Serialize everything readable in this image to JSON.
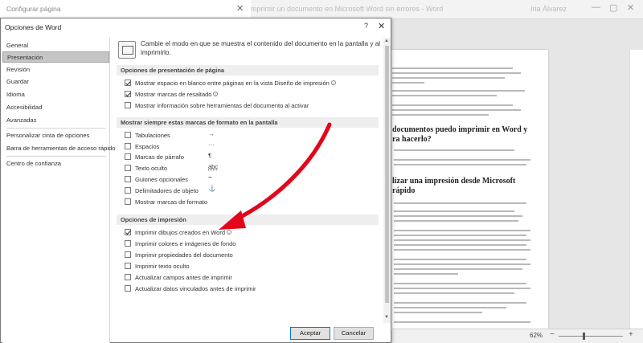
{
  "word": {
    "title": "imprimir un documento en Microsoft Word sin errores  -  Word",
    "user": "Iria Álvarez",
    "zoom": "62%",
    "headings": [
      "documentos puedo imprimir en Word y",
      "ra hacerlo?",
      "lizar una impresión desde Microsoft",
      "rápido"
    ]
  },
  "config_window": {
    "title": "Configurar página"
  },
  "dialog": {
    "title": "Opciones de Word",
    "help_icon": "?",
    "close_icon": "✕",
    "intro": "Cambie el modo en que se muestra el contenido del documento en la pantalla y al imprimirlo."
  },
  "sidebar": {
    "items": [
      {
        "label": "General",
        "selected": false
      },
      {
        "label": "Presentación",
        "selected": true
      },
      {
        "label": "Revisión",
        "selected": false
      },
      {
        "label": "Guardar",
        "selected": false
      },
      {
        "label": "Idioma",
        "selected": false
      },
      {
        "label": "Accesibilidad",
        "selected": false
      },
      {
        "label": "Avanzadas",
        "selected": false
      },
      {
        "label": "Personalizar cinta de opciones",
        "selected": false
      },
      {
        "label": "Barra de herramientas de acceso rápido",
        "selected": false
      },
      {
        "label": "Centro de confianza",
        "selected": false
      }
    ]
  },
  "sections": {
    "page_display": {
      "header": "Opciones de presentación de página",
      "options": [
        {
          "label": "Mostrar espacio en blanco entre páginas en la vista Diseño de impresión",
          "checked": true,
          "info": true
        },
        {
          "label": "Mostrar marcas de resaltado",
          "checked": true,
          "info": true
        },
        {
          "label": "Mostrar información sobre herramientas del documento al activar",
          "checked": false,
          "info": false
        }
      ]
    },
    "formatting_marks": {
      "header": "Mostrar siempre estas marcas de formato en la pantalla",
      "options": [
        {
          "label": "Tabulaciones",
          "checked": false,
          "mark": "→"
        },
        {
          "label": "Espacios",
          "checked": false,
          "mark": "···"
        },
        {
          "label": "Marcas de párrafo",
          "checked": false,
          "mark": "¶"
        },
        {
          "label": "Texto oculto",
          "checked": false,
          "mark": "abc"
        },
        {
          "label": "Guiones opcionales",
          "checked": false,
          "mark": "¬"
        },
        {
          "label": "Delimitadores de objeto",
          "checked": false,
          "mark": "⚓"
        },
        {
          "label": "Mostrar marcas de formato",
          "checked": false,
          "mark": ""
        }
      ]
    },
    "printing": {
      "header": "Opciones de impresión",
      "options": [
        {
          "label": "Imprimir dibujos creados en Word",
          "checked": true,
          "info": true
        },
        {
          "label": "Imprimir colores e imágenes de fondo",
          "checked": false,
          "info": false
        },
        {
          "label": "Imprimir propiedades del documento",
          "checked": false,
          "info": false
        },
        {
          "label": "Imprimir texto oculto",
          "checked": false,
          "info": false
        },
        {
          "label": "Actualizar campos antes de imprimir",
          "checked": false,
          "info": false
        },
        {
          "label": "Actualizar datos vinculados antes de imprimir",
          "checked": false,
          "info": false
        }
      ]
    }
  },
  "buttons": {
    "accept": "Aceptar",
    "cancel": "Cancelar"
  },
  "colors": {
    "annotation_arrow": "#e3061b",
    "selected_item": "#c5c5c5",
    "section_header": "#eeeeee"
  }
}
